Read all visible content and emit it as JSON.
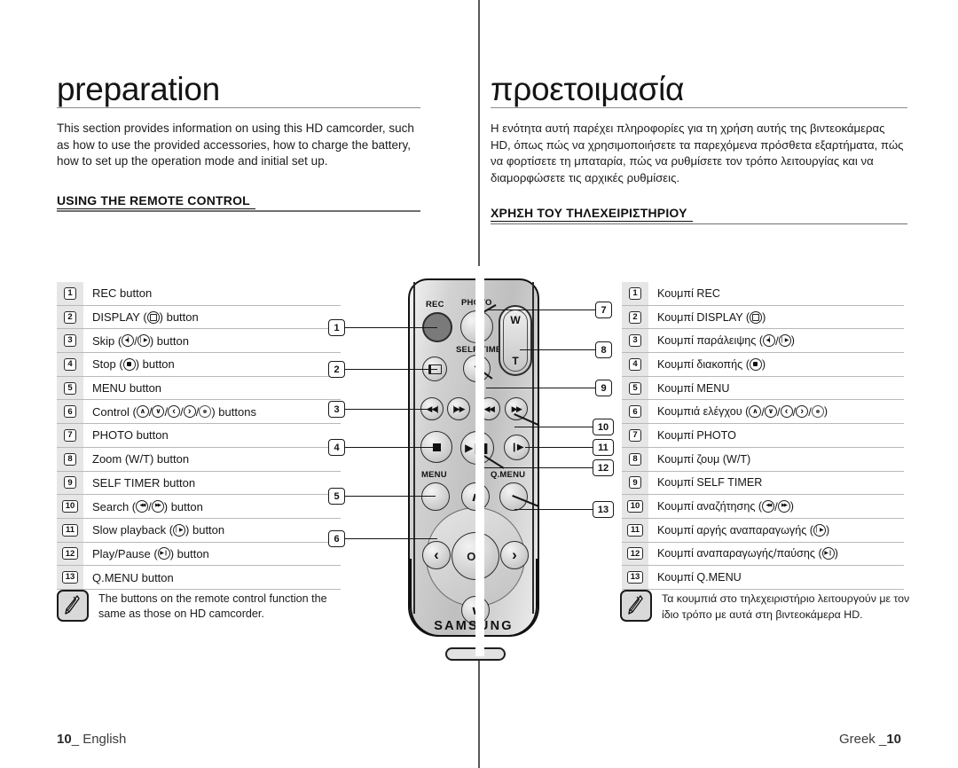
{
  "page": {
    "footer_left_num": "10",
    "footer_left_lang": "English",
    "footer_right_lang": "Greek",
    "footer_right_num": "10"
  },
  "english": {
    "chapter_title": "preparation",
    "intro": "This section provides information on using this HD camcorder, such as how to use the provided accessories, how to charge the battery, how to set up the operation mode and initial set up.",
    "section_title": "USING THE REMOTE CONTROL",
    "items": [
      {
        "num": "1",
        "pre": "REC button",
        "glyphs": [],
        "post": ""
      },
      {
        "num": "2",
        "pre": "DISPLAY (",
        "glyphs": [
          "display"
        ],
        "post": ") button"
      },
      {
        "num": "3",
        "pre": "Skip (",
        "glyphs": [
          "prev",
          "next"
        ],
        "post": ") button"
      },
      {
        "num": "4",
        "pre": "Stop (",
        "glyphs": [
          "dot"
        ],
        "post": ") button"
      },
      {
        "num": "5",
        "pre": "MENU button",
        "glyphs": [],
        "post": ""
      },
      {
        "num": "6",
        "pre": "Control (",
        "glyphs": [
          "up",
          "down",
          "left",
          "right",
          "ok"
        ],
        "post": ") buttons"
      },
      {
        "num": "7",
        "pre": "PHOTO button",
        "glyphs": [],
        "post": ""
      },
      {
        "num": "8",
        "pre": "Zoom (W/T) button",
        "glyphs": [],
        "post": ""
      },
      {
        "num": "9",
        "pre": "SELF TIMER button",
        "glyphs": [],
        "post": ""
      },
      {
        "num": "10",
        "pre": "Search (",
        "glyphs": [
          "rew",
          "ff"
        ],
        "post": ") button"
      },
      {
        "num": "11",
        "pre": "Slow playback (",
        "glyphs": [
          "play"
        ],
        "post": ") button"
      },
      {
        "num": "12",
        "pre": "Play/Pause (",
        "glyphs": [
          "playpause"
        ],
        "post": ") button"
      },
      {
        "num": "13",
        "pre": "Q.MENU button",
        "glyphs": [],
        "post": ""
      }
    ],
    "note": "The buttons on the remote control function the same as those on HD camcorder."
  },
  "greek": {
    "chapter_title": "προετοιμασία",
    "intro": "Η ενότητα αυτή παρέχει πληροφορίες για τη χρήση αυτής της βιντεοκάμερας HD, όπως πώς να χρησιμοποιήσετε τα παρεχόμενα πρόσθετα εξαρτήματα, πώς να φορτίσετε τη μπαταρία, πώς να ρυθμίσετε τον τρόπο λειτουργίας και να διαμορφώσετε τις αρχικές ρυθμίσεις.",
    "section_title": "ΧΡΗΣΗ ΤΟΥ ΤΗΛΕΧΕΙΡΙΣΤΗΡΙΟΥ",
    "items": [
      {
        "num": "1",
        "pre": "Κουμπί REC",
        "glyphs": [],
        "post": ""
      },
      {
        "num": "2",
        "pre": "Κουμπί DISPLAY (",
        "glyphs": [
          "display"
        ],
        "post": ")"
      },
      {
        "num": "3",
        "pre": "Κουμπί παράλειψης (",
        "glyphs": [
          "prev",
          "next"
        ],
        "post": ")"
      },
      {
        "num": "4",
        "pre": "Κουμπί διακοπής (",
        "glyphs": [
          "dot"
        ],
        "post": ")"
      },
      {
        "num": "5",
        "pre": "Κουμπί MENU",
        "glyphs": [],
        "post": ""
      },
      {
        "num": "6",
        "pre": "Κουμπιά ελέγχου (",
        "glyphs": [
          "up",
          "down",
          "left",
          "right",
          "ok"
        ],
        "post": ")"
      },
      {
        "num": "7",
        "pre": "Κουμπί PHOTO",
        "glyphs": [],
        "post": ""
      },
      {
        "num": "8",
        "pre": "Κουμπί ζουμ (W/T)",
        "glyphs": [],
        "post": ""
      },
      {
        "num": "9",
        "pre": "Κουμπί SELF TIMER",
        "glyphs": [],
        "post": ""
      },
      {
        "num": "10",
        "pre": "Κουμπί αναζήτησης (",
        "glyphs": [
          "rew",
          "ff"
        ],
        "post": ")"
      },
      {
        "num": "11",
        "pre": "Κουμπί αργής αναπαραγωγής (",
        "glyphs": [
          "play"
        ],
        "post": ")"
      },
      {
        "num": "12",
        "pre": "Κουμπί αναπαραγωγής/παύσης (",
        "glyphs": [
          "playpause"
        ],
        "post": ")"
      },
      {
        "num": "13",
        "pre": "Κουμπί Q.MENU",
        "glyphs": [],
        "post": ""
      }
    ],
    "note": "Τα κουμπιά στο τηλεχειριστήριο λειτουργούν με τον ίδιο τρόπο με αυτά στη βιντεοκάμερα HD."
  },
  "remote": {
    "brand": "SAMSUNG",
    "labels": {
      "rec": "REC",
      "photo": "PHOTO",
      "self_timer": "SELF TIMER",
      "menu": "MENU",
      "qmenu": "Q.MENU",
      "zoom_wide": "W",
      "zoom_tele": "T",
      "ok": "OK"
    },
    "callouts_left": [
      "1",
      "2",
      "3",
      "4",
      "5",
      "6"
    ],
    "callouts_right": [
      "7",
      "8",
      "9",
      "10",
      "11",
      "12",
      "13"
    ]
  },
  "colors": {
    "page_bg": "#ffffff",
    "text": "#1a1a1a",
    "rule": "#8d8d8d",
    "divider": "#58595b",
    "row_num_bg": "#e6e6e6",
    "row_rule": "#b9b9b9",
    "note_icon_bg": "#d9d9d9",
    "rec_button": "#7a7a7a"
  }
}
